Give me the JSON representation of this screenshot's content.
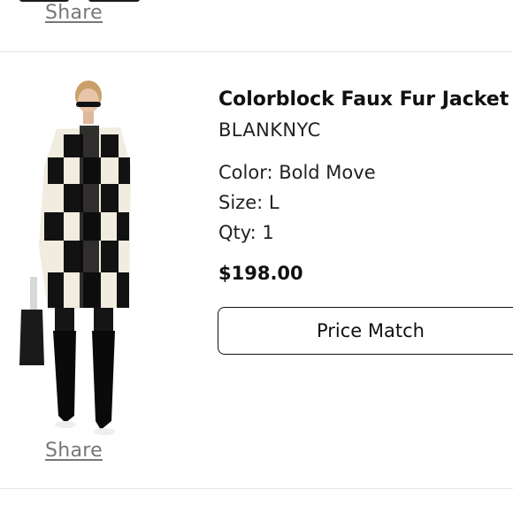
{
  "top_item": {
    "share_label": "Share"
  },
  "product": {
    "title": "Colorblock Faux Fur Jacket",
    "brand": "BLANKNYC",
    "color_text": "Color: Bold Move",
    "size_text": "Size: L",
    "qty_text": "Qty: 1",
    "price": "$198.00",
    "price_match_label": "Price Match",
    "share_label": "Share",
    "image_icon": "product-photo-checkered-coat"
  },
  "colors": {
    "text": "#111111",
    "muted_link": "#777777",
    "divider": "#e6e6e6",
    "button_border": "#111111"
  }
}
